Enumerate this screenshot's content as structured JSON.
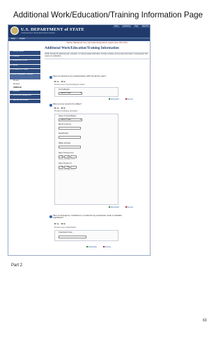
{
  "page": {
    "heading": "Additional Work/Education/Training Information Page",
    "part_label": "Part 2",
    "page_number": "63"
  },
  "banner": {
    "department": "U.S. DEPARTMENT of STATE",
    "system": "CONSULAR ELECTRONIC APPLICATION CENTER",
    "links": [
      "Home",
      "Contact Us",
      "Help",
      "Sign Out"
    ],
    "nav_items": [
      "FAQs",
      "Contact"
    ]
  },
  "sidebar": {
    "items": [
      "Getting Started",
      "Personal",
      "Address and Phone",
      "Family",
      "Previous U.S. Travel",
      "Work / Education / Training"
    ],
    "sub_items": [
      "Present",
      "Previous",
      "Additional"
    ],
    "items_after": [
      "Petitioner",
      "Security and Background",
      "Sign/Security Review"
    ]
  },
  "main": {
    "form_title": "Online Immigrant Visa and Alien Registration Application (DS-260)",
    "section_title": "Additional Work/Education/Training Information",
    "note": "NOTE: Provide the following work, education, or training related information. Provide complete and accurate information to all questions that require an explanation.",
    "yes": "Yes",
    "no": "No",
    "add_another": "Add Another",
    "remove": "Remove",
    "q1": {
      "text": "Have you traveled to any countries/regions within the last five years?",
      "list_caption": "Provide a List of Countries/Regions Visited",
      "field_label": "Country/Region",
      "select_value": "- SELECT ONE -"
    },
    "q2": {
      "text": "Have you ever served in the military?",
      "list_caption": "Provide the following information:",
      "fields": {
        "country": "Name of Country/Region",
        "country_value": "- SELECT ONE -",
        "branch": "Branch of Service",
        "rank": "Rank/Position",
        "specialty": "Military Specialty",
        "from": "Date of Service From",
        "to": "Date of Service To",
        "format_hint": "(Format: DD-MMM-YYYY)"
      }
    },
    "q3": {
      "text": "Have you belonged to, contributed to, or worked for any professional, social, or charitable organization?",
      "list_caption": "Provide a List of Organizations",
      "field_label": "Organization Name"
    }
  }
}
